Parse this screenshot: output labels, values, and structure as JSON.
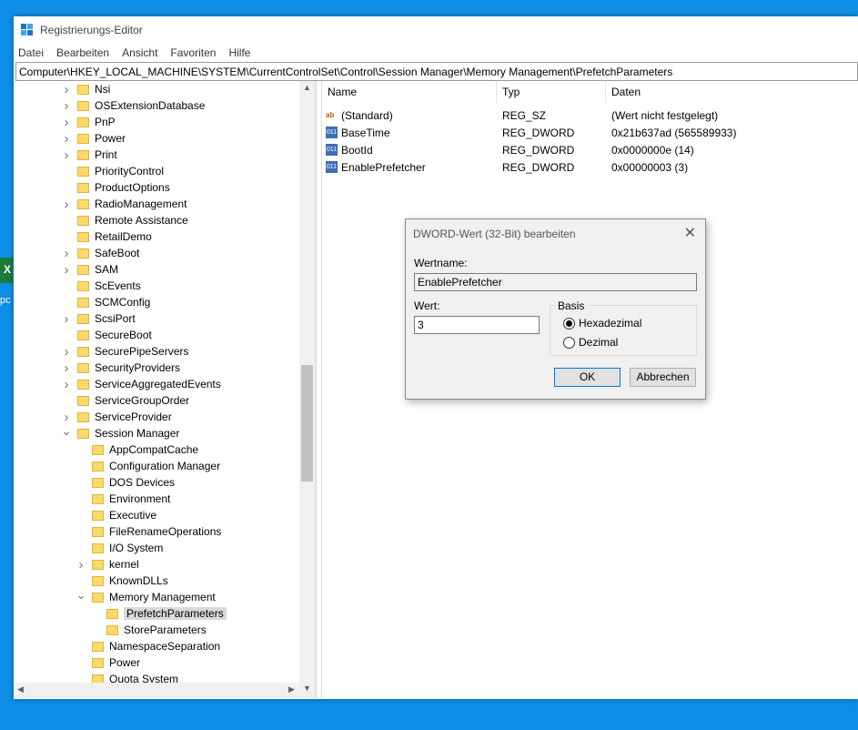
{
  "window": {
    "title": "Registrierungs-Editor"
  },
  "menu": [
    "Datei",
    "Bearbeiten",
    "Ansicht",
    "Favoriten",
    "Hilfe"
  ],
  "address": "Computer\\HKEY_LOCAL_MACHINE\\SYSTEM\\CurrentControlSet\\Control\\Session Manager\\Memory Management\\PrefetchParameters",
  "desktop": {
    "icon_letter": "X",
    "label": "pc"
  },
  "tree": [
    {
      "label": "Nsi",
      "level": 0,
      "chevron": "right"
    },
    {
      "label": "OSExtensionDatabase",
      "level": 0,
      "chevron": "right"
    },
    {
      "label": "PnP",
      "level": 0,
      "chevron": "right"
    },
    {
      "label": "Power",
      "level": 0,
      "chevron": "right"
    },
    {
      "label": "Print",
      "level": 0,
      "chevron": "right"
    },
    {
      "label": "PriorityControl",
      "level": 0,
      "chevron": ""
    },
    {
      "label": "ProductOptions",
      "level": 0,
      "chevron": ""
    },
    {
      "label": "RadioManagement",
      "level": 0,
      "chevron": "right"
    },
    {
      "label": "Remote Assistance",
      "level": 0,
      "chevron": ""
    },
    {
      "label": "RetailDemo",
      "level": 0,
      "chevron": ""
    },
    {
      "label": "SafeBoot",
      "level": 0,
      "chevron": "right"
    },
    {
      "label": "SAM",
      "level": 0,
      "chevron": "right"
    },
    {
      "label": "ScEvents",
      "level": 0,
      "chevron": ""
    },
    {
      "label": "SCMConfig",
      "level": 0,
      "chevron": ""
    },
    {
      "label": "ScsiPort",
      "level": 0,
      "chevron": "right"
    },
    {
      "label": "SecureBoot",
      "level": 0,
      "chevron": ""
    },
    {
      "label": "SecurePipeServers",
      "level": 0,
      "chevron": "right"
    },
    {
      "label": "SecurityProviders",
      "level": 0,
      "chevron": "right"
    },
    {
      "label": "ServiceAggregatedEvents",
      "level": 0,
      "chevron": "right"
    },
    {
      "label": "ServiceGroupOrder",
      "level": 0,
      "chevron": ""
    },
    {
      "label": "ServiceProvider",
      "level": 0,
      "chevron": "right"
    },
    {
      "label": "Session Manager",
      "level": 0,
      "chevron": "down"
    },
    {
      "label": "AppCompatCache",
      "level": 1,
      "chevron": ""
    },
    {
      "label": "Configuration Manager",
      "level": 1,
      "chevron": ""
    },
    {
      "label": "DOS Devices",
      "level": 1,
      "chevron": ""
    },
    {
      "label": "Environment",
      "level": 1,
      "chevron": ""
    },
    {
      "label": "Executive",
      "level": 1,
      "chevron": ""
    },
    {
      "label": "FileRenameOperations",
      "level": 1,
      "chevron": ""
    },
    {
      "label": "I/O System",
      "level": 1,
      "chevron": ""
    },
    {
      "label": "kernel",
      "level": 1,
      "chevron": "right"
    },
    {
      "label": "KnownDLLs",
      "level": 1,
      "chevron": ""
    },
    {
      "label": "Memory Management",
      "level": 1,
      "chevron": "down"
    },
    {
      "label": "PrefetchParameters",
      "level": 2,
      "chevron": "",
      "selected": true
    },
    {
      "label": "StoreParameters",
      "level": 2,
      "chevron": ""
    },
    {
      "label": "NamespaceSeparation",
      "level": 1,
      "chevron": ""
    },
    {
      "label": "Power",
      "level": 1,
      "chevron": ""
    },
    {
      "label": "Quota System",
      "level": 1,
      "chevron": ""
    }
  ],
  "list": {
    "columns": [
      "Name",
      "Typ",
      "Daten"
    ],
    "rows": [
      {
        "icon": "string-value-icon",
        "name": "(Standard)",
        "type": "REG_SZ",
        "data": "(Wert nicht festgelegt)"
      },
      {
        "icon": "dword-value-icon",
        "name": "BaseTime",
        "type": "REG_DWORD",
        "data": "0x21b637ad (565589933)"
      },
      {
        "icon": "dword-value-icon",
        "name": "BootId",
        "type": "REG_DWORD",
        "data": "0x0000000e (14)"
      },
      {
        "icon": "dword-value-icon",
        "name": "EnablePrefetcher",
        "type": "REG_DWORD",
        "data": "0x00000003 (3)"
      }
    ]
  },
  "dialog": {
    "title": "DWORD-Wert (32-Bit) bearbeiten",
    "close": "✕",
    "name_label": "Wertname:",
    "name_value": "EnablePrefetcher",
    "value_label": "Wert:",
    "value": "3",
    "basis_label": "Basis",
    "radio_hex": "Hexadezimal",
    "radio_dec": "Dezimal",
    "ok": "OK",
    "cancel": "Abbrechen"
  }
}
